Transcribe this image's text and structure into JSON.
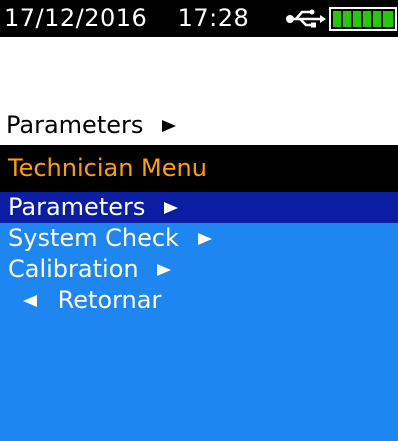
{
  "status": {
    "date": "17/12/2016",
    "time": "17:28",
    "usb_icon": "usb-icon",
    "battery_icon": "battery-icon",
    "battery_color": "#22cc00"
  },
  "breadcrumb": {
    "label": "Parameters",
    "icon": "triangle-right-icon"
  },
  "title": {
    "label": "Technician Menu",
    "color": "#ffa000"
  },
  "menu": {
    "items": [
      {
        "label": "Parameters",
        "icon": "triangle-right-icon",
        "selected": true
      },
      {
        "label": "System Check",
        "icon": "triangle-right-icon",
        "selected": false
      },
      {
        "label": "Calibration",
        "icon": "triangle-right-icon",
        "selected": false
      },
      {
        "label": "Retornar",
        "icon": "triangle-left-icon",
        "selected": false
      }
    ]
  },
  "colors": {
    "menu_background": "#1e86f0",
    "selected_background": "#0b1da2",
    "title_background": "#000000"
  }
}
